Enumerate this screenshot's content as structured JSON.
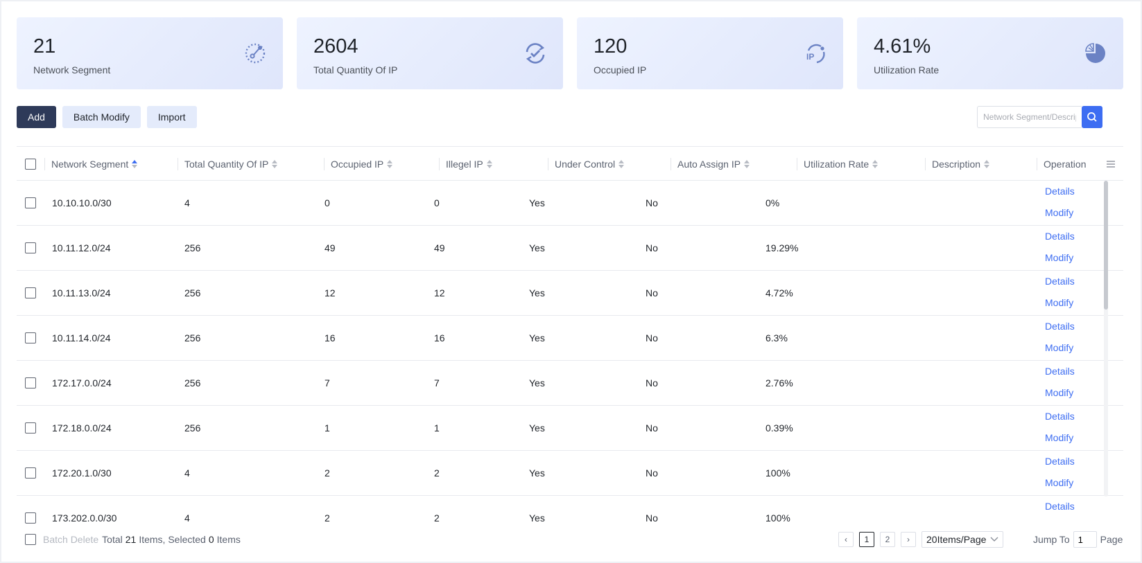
{
  "stats": [
    {
      "value": "21",
      "label": "Network Segment",
      "icon": "network-segment-icon"
    },
    {
      "value": "2604",
      "label": "Total Quantity Of IP",
      "icon": "refresh-check-icon"
    },
    {
      "value": "120",
      "label": "Occupied IP",
      "icon": "ip-cycle-icon"
    },
    {
      "value": "4.61%",
      "label": "Utilization Rate",
      "icon": "pie-chart-icon"
    }
  ],
  "toolbar": {
    "add": "Add",
    "batch_modify": "Batch Modify",
    "import": "Import"
  },
  "search": {
    "placeholder": "Network Segment/Description",
    "value": ""
  },
  "columns": [
    "Network Segment",
    "Total Quantity Of IP",
    "Occupied IP",
    "Illegel IP",
    "Under Control",
    "Auto Assign IP",
    "Utilization Rate",
    "Description",
    "Operation"
  ],
  "rows": [
    {
      "segment": "10.10.10.0/30",
      "total": "4",
      "occupied": "0",
      "illegal": "0",
      "control": "Yes",
      "auto": "No",
      "rate": "0%",
      "desc": ""
    },
    {
      "segment": "10.11.12.0/24",
      "total": "256",
      "occupied": "49",
      "illegal": "49",
      "control": "Yes",
      "auto": "No",
      "rate": "19.29%",
      "desc": ""
    },
    {
      "segment": "10.11.13.0/24",
      "total": "256",
      "occupied": "12",
      "illegal": "12",
      "control": "Yes",
      "auto": "No",
      "rate": "4.72%",
      "desc": ""
    },
    {
      "segment": "10.11.14.0/24",
      "total": "256",
      "occupied": "16",
      "illegal": "16",
      "control": "Yes",
      "auto": "No",
      "rate": "6.3%",
      "desc": ""
    },
    {
      "segment": "172.17.0.0/24",
      "total": "256",
      "occupied": "7",
      "illegal": "7",
      "control": "Yes",
      "auto": "No",
      "rate": "2.76%",
      "desc": ""
    },
    {
      "segment": "172.18.0.0/24",
      "total": "256",
      "occupied": "1",
      "illegal": "1",
      "control": "Yes",
      "auto": "No",
      "rate": "0.39%",
      "desc": ""
    },
    {
      "segment": "172.20.1.0/30",
      "total": "4",
      "occupied": "2",
      "illegal": "2",
      "control": "Yes",
      "auto": "No",
      "rate": "100%",
      "desc": ""
    },
    {
      "segment": "173.202.0.0/30",
      "total": "4",
      "occupied": "2",
      "illegal": "2",
      "control": "Yes",
      "auto": "No",
      "rate": "100%",
      "desc": ""
    }
  ],
  "row_actions": {
    "details": "Details",
    "modify": "Modify"
  },
  "footer": {
    "batch_delete": "Batch Delete",
    "total_prefix": "Total",
    "total": "21",
    "items_selected": "Items, Selected",
    "selected": "0",
    "items": "Items",
    "pages": [
      "1",
      "2"
    ],
    "page_size": "20Items/Page",
    "jump_to": "Jump To",
    "jump_value": "1",
    "page_label": "Page"
  },
  "colors": {
    "primary_button": "#2e3a59",
    "link": "#3d6df2",
    "search_button": "#3d6df2",
    "card_icon": "#6b82c4"
  }
}
